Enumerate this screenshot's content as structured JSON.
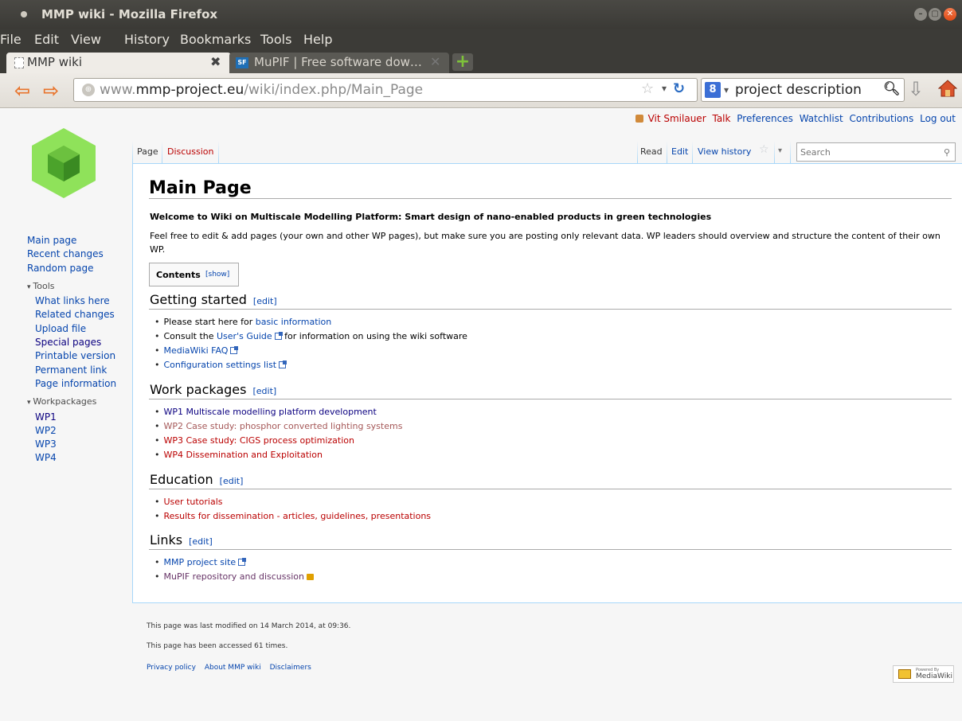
{
  "window": {
    "title": "MMP wiki - Mozilla Firefox"
  },
  "menu": [
    "File",
    "Edit",
    "View",
    "History",
    "Bookmarks",
    "Tools",
    "Help"
  ],
  "tabs": [
    {
      "label": "MMP wiki",
      "icon": "blank-page-icon",
      "active": true
    },
    {
      "label": "MuPIF | Free software dow…",
      "icon": "sourceforge-icon",
      "active": false
    }
  ],
  "nav": {
    "url_prefix": "www.",
    "url_domain": "mmp-project.eu",
    "url_path": "/wiki/index.php/Main_Page",
    "search_value": "project description"
  },
  "personal": {
    "user": "Vit Smilauer",
    "talk": "Talk",
    "preferences": "Preferences",
    "watchlist": "Watchlist",
    "contributions": "Contributions",
    "logout": "Log out"
  },
  "sidebar": {
    "nav": [
      "Main page",
      "Recent changes",
      "Random page"
    ],
    "tools_title": "Tools",
    "tools": [
      "What links here",
      "Related changes",
      "Upload file",
      "Special pages",
      "Printable version",
      "Permanent link",
      "Page information"
    ],
    "wp_title": "Workpackages",
    "wp": [
      "WP1",
      "WP2",
      "WP3",
      "WP4"
    ]
  },
  "page_tabs": {
    "page": "Page",
    "discussion": "Discussion",
    "read": "Read",
    "edit": "Edit",
    "history": "View history",
    "search_placeholder": "Search"
  },
  "article": {
    "title": "Main Page",
    "intro_bold": "Welcome to Wiki on Multiscale Modelling Platform: Smart design of nano-enabled products in green technologies",
    "intro": "Feel free to edit & add pages (your own and other WP pages), but make sure you are posting only relevant data. WP leaders should overview and structure the content of their own WP.",
    "toc_title": "Contents",
    "toc_show": "[show]",
    "edit_label": "edit",
    "sections": {
      "getting_started": {
        "title": "Getting started",
        "items": [
          {
            "pre": "Please start here for ",
            "link": "basic information",
            "post": ""
          },
          {
            "pre": "Consult the ",
            "link": "User's Guide",
            "post": " for information on using the wiki software"
          },
          {
            "pre": "",
            "link": "MediaWiki FAQ",
            "post": ""
          },
          {
            "pre": "",
            "link": "Configuration settings list",
            "post": ""
          }
        ]
      },
      "work_packages": {
        "title": "Work packages",
        "items": [
          "WP1 Multiscale modelling platform development",
          "WP2 Case study: phosphor converted lighting systems",
          "WP3 Case study: CIGS process optimization",
          "WP4 Dissemination and Exploitation"
        ]
      },
      "education": {
        "title": "Education",
        "items": [
          "User tutorials",
          "Results for dissemination - articles, guidelines, presentations"
        ]
      },
      "links": {
        "title": "Links",
        "items": [
          "MMP project site",
          "MuPIF repository and discussion"
        ]
      }
    }
  },
  "footer": {
    "modified": "This page was last modified on 14 March 2014, at 09:36.",
    "accessed": "This page has been accessed 61 times.",
    "privacy": "Privacy policy",
    "about": "About MMP wiki",
    "disclaimers": "Disclaimers",
    "badge_small": "Powered By",
    "badge": "MediaWiki"
  }
}
